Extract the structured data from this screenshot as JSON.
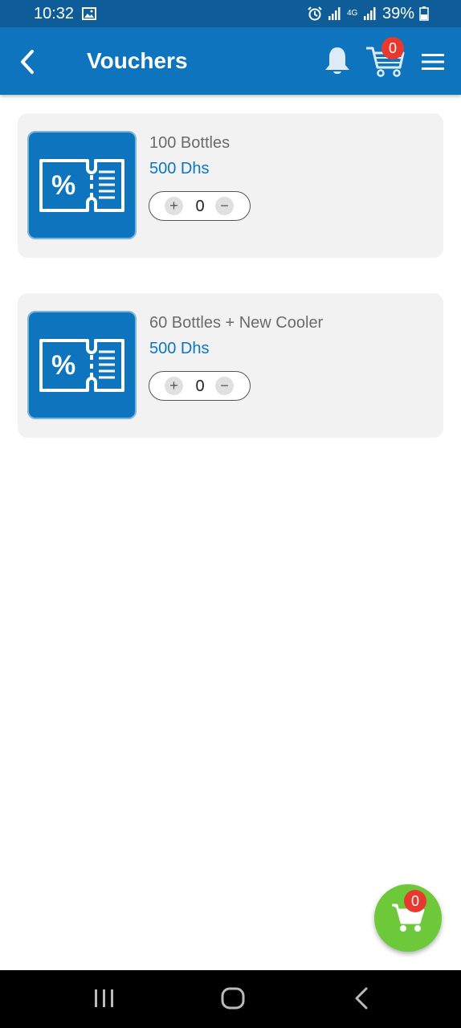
{
  "status_bar": {
    "time": "10:32",
    "battery": "39%",
    "network": "4G"
  },
  "header": {
    "title": "Vouchers",
    "cart_count": "0",
    "color": "#0d74bd"
  },
  "vouchers": [
    {
      "name": "100 Bottles",
      "price": "500 Dhs",
      "quantity": "0",
      "plus": "+",
      "minus": "−"
    },
    {
      "name": "60 Bottles + New Cooler",
      "price": "500 Dhs",
      "quantity": "0",
      "plus": "+",
      "minus": "−"
    }
  ],
  "fab": {
    "cart_count": "0",
    "color": "#6dc93a"
  },
  "icons": {
    "back": "chevron-left-icon",
    "bell": "bell-icon",
    "cart": "cart-icon",
    "menu": "hamburger-icon",
    "voucher": "voucher-icon"
  }
}
